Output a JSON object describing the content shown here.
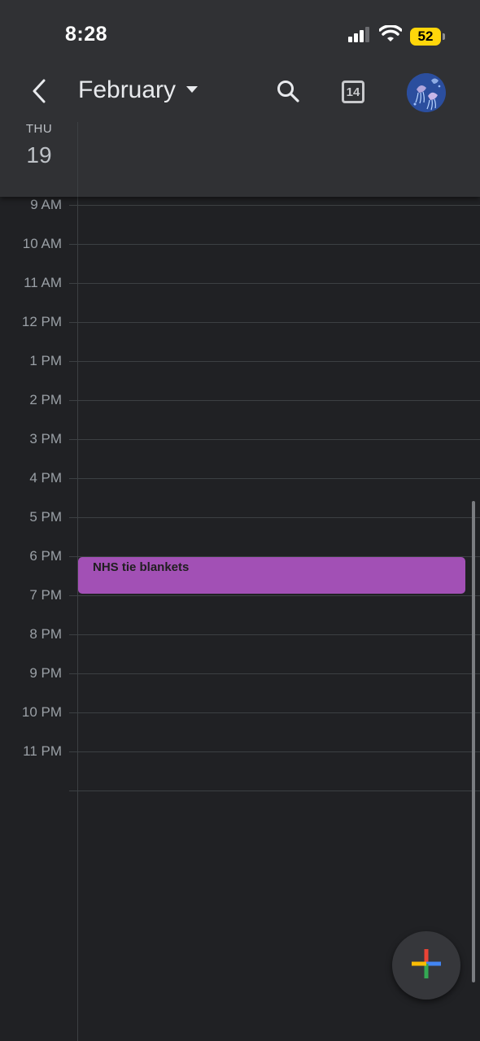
{
  "status_bar": {
    "time": "8:28",
    "battery": "52",
    "battery_color": "#ffd60a"
  },
  "toolbar": {
    "back_icon": "chevron-left-icon",
    "month": "February",
    "dropdown_icon": "caret-down-icon",
    "search_icon": "search-icon",
    "today_number": "14",
    "avatar_icon": "jellyfish-avatar"
  },
  "day_header": {
    "day_name": "THU",
    "day_number": "19"
  },
  "hours": [
    "9 AM",
    "10 AM",
    "11 AM",
    "12 PM",
    "1 PM",
    "2 PM",
    "3 PM",
    "4 PM",
    "5 PM",
    "6 PM",
    "7 PM",
    "8 PM",
    "9 PM",
    "10 PM",
    "11 PM",
    ""
  ],
  "events": [
    {
      "title": "NHS tie blankets",
      "color": "#a250b5"
    }
  ],
  "fab": {
    "icon": "google-plus-icon"
  },
  "colors": {
    "background": "#202124",
    "header": "#303134",
    "gridline": "#3c4043",
    "hour_label": "#9aa0a6"
  }
}
